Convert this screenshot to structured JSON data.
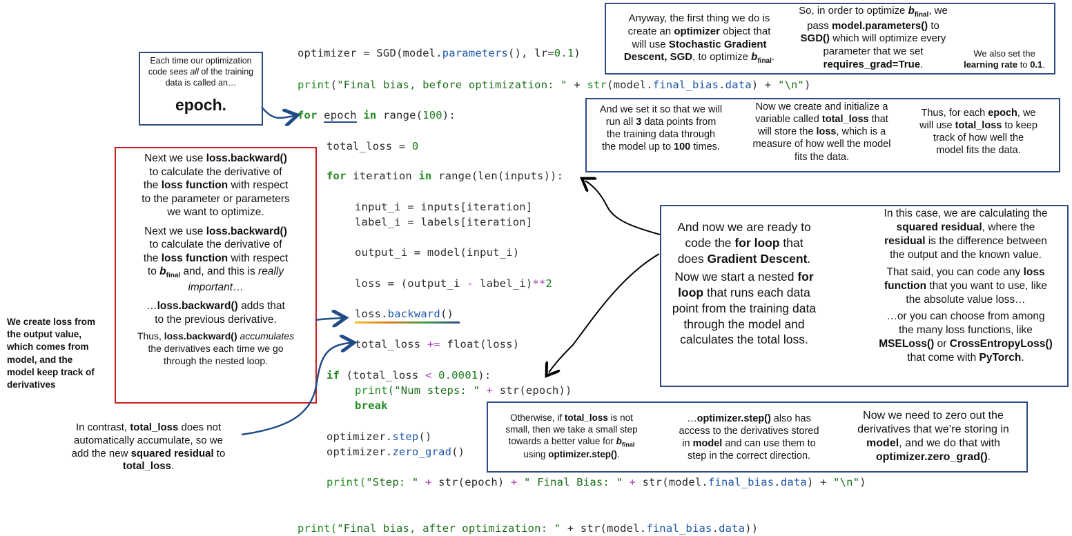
{
  "code": {
    "line1": {
      "a": "optimizer = SGD(model.",
      "b": "parameters",
      "c": "(), lr=",
      "d": "0.1",
      ")": ")"
    },
    "line2": {
      "fn": "print",
      "s": "\"Final bias, before optimization: \"",
      "p": " + ",
      "str": "str",
      "m": "(model.",
      "attr": "final_bias",
      "dot": ".",
      "data": "data",
      "q": ") + ",
      "nl": "\"\\n\"",
      "end": ")"
    },
    "line3": {
      "kw": "for",
      "sp": " ",
      "var": "epoch",
      "in": " in ",
      "rng": "range(",
      "n": "100",
      "end": "):"
    },
    "line4": {
      "a": "total_loss = ",
      "n": "0"
    },
    "line5": {
      "kw": "for",
      "a": " iteration ",
      "in": "in",
      "b": " range(len(inputs)):"
    },
    "line6": "input_i = inputs[iteration]",
    "line7": "label_i = labels[iteration]",
    "line8": "output_i = model(input_i)",
    "line9": {
      "a": "loss = (output_i ",
      "op": "-",
      "b": " label_i)",
      "op2": "**",
      "n": "2"
    },
    "line10": {
      "a": "loss.",
      "b": "backward",
      "c": "()"
    },
    "line11": {
      "a": "total_loss ",
      "op": "+=",
      "b": " float(loss)"
    },
    "line12": {
      "kw": "if",
      "a": " (total_loss ",
      "op": "<",
      "n": " 0.0001",
      "b": "):"
    },
    "line13": {
      "fn": "print",
      "s": "(\"Num steps: \"",
      "op": " + ",
      "b": "str(epoch))"
    },
    "line14": "break",
    "line15": {
      "a": "optimizer.",
      "b": "step",
      "c": "()"
    },
    "line16": {
      "a": "optimizer.",
      "b": "zero_grad",
      "c": "()"
    },
    "line17": {
      "fn": "print(",
      "s1": "\"Step: \"",
      "p1": " + ",
      "a": "str(epoch)",
      "p2": " + ",
      "s2": "\" Final Bias: \"",
      "p3": " + ",
      "b": "str(model.",
      "attr": "final_bias",
      "c": ".",
      "d": "data",
      "e": ") + ",
      "nl": "\"\\n\"",
      "end": ")"
    },
    "line18": {
      "fn": "print(",
      "s": "\"Final bias, after optimization: \"",
      "p": " + ",
      "a": "str(model.",
      "attr": "final_bias",
      "c": ".",
      "d": "data",
      "end": "))"
    }
  },
  "notes": {
    "epoch_box": {
      "l1": "Each time our optimization",
      "l2a": "code sees ",
      "l2b": "all",
      "l2c": " of the training",
      "l3": "data is called an…",
      "big": "epoch."
    },
    "optimizer_note": {
      "t1": "Anyway, the first thing we do is",
      "t2a": "create an ",
      "t2b": "optimizer",
      "t2c": " object that",
      "t3": "will use ",
      "t3b": "Stochastic Gradient",
      "t4": "Descent, SGD",
      "t4b": ", to optimize ",
      "t4c": "b",
      "t4d": "final",
      "t4e": "."
    },
    "params_note": {
      "t1a": "So, in order to optimize ",
      "t1b": "b",
      "t1c": "final",
      "t1d": ", we",
      "t2a": "pass ",
      "t2b": "model.parameters()",
      "t2c": " to",
      "t3a": "SGD()",
      "t3b": " which will optimize every",
      "t4": "parameter that we set",
      "t5": "requires_grad=True",
      "t5b": "."
    },
    "lr_note": {
      "t1": "We also set the",
      "t2": "learning rate",
      "t3": " to ",
      "t4": "0.1",
      "t5": "."
    },
    "run_note": {
      "t1": "And we set it so that we will",
      "t2a": "run all ",
      "t2b": "3",
      "t2c": " data points from",
      "t3": "the training data through",
      "t4a": "the model up to ",
      "t4b": "100",
      "t4c": " times."
    },
    "totalloss_note": {
      "t1": "Now we create and initialize a",
      "t2a": "variable called ",
      "t2b": "total_loss",
      "t2c": " that",
      "t3a": "will store the ",
      "t3b": "loss",
      "t3c": ", which is a",
      "t4": "measure of how well the model",
      "t5": "fits the data."
    },
    "epoch_note": {
      "t1a": "Thus, for each ",
      "t1b": "epoch",
      "t1c": ", we",
      "t2a": "will use ",
      "t2b": "total_loss",
      "t2c": " to keep",
      "t3": "track of how well the",
      "t4": "model fits the data."
    },
    "backward_note": {
      "p1l1a": "Next we use ",
      "p1l1b": "loss.backward()",
      "p1l2": "to calculate the derivative of",
      "p1l3a": "the ",
      "p1l3b": "loss function",
      "p1l3c": " with respect",
      "p1l4": "to the parameter or parameters",
      "p1l5": "we want to optimize.",
      "p2l1a": "Next we use ",
      "p2l1b": "loss.backward()",
      "p2l2": "to calculate the derivative of",
      "p2l3a": "the ",
      "p2l3b": "loss function",
      "p2l3c": " with respect",
      "p2l4a": "to ",
      "p2l4b": "b",
      "p2l4c": "final",
      "p2l4d": " and, and this is ",
      "p2l4e": "really",
      "p2l5": "important",
      "p2l5b": "…",
      "p3l1a": "…",
      "p3l1b": "loss.backward()",
      "p3l1c": " adds that",
      "p3l2": "to the previous derivative.",
      "p4l1a": "Thus, ",
      "p4l1b": "loss.backward()",
      "p4l1c": " accumulates",
      "p4l2": "the derivatives each time we go",
      "p4l3": "through the nested loop."
    },
    "left_note": [
      "We create loss from",
      "the output value,",
      "which comes from",
      "model, and the",
      "model keep track of",
      "derivatives"
    ],
    "contrast_note": {
      "t1a": "In contrast, ",
      "t1b": "total_loss",
      "t1c": " does not",
      "t2": "automatically accumulate, so we",
      "t3a": "add the new ",
      "t3b": "squared residual",
      "t3c": " to",
      "t4": "total_loss",
      "t4b": "."
    },
    "forloop_note": {
      "t1": "And now we are ready to",
      "t2a": "code the ",
      "t2b": "for loop",
      "t2c": " that",
      "t3a": "does ",
      "t3b": "Gradient Descent",
      "t3c": ".",
      "t4a": "Now we start a nested ",
      "t4b": "for",
      "t5a": "loop",
      "t5b": " that runs each data",
      "t6": "point from the training data",
      "t7": "through the model and",
      "t8": "calculates the total loss."
    },
    "residual_note": {
      "t1": "In this case, we are calculating the",
      "t2": "squared residual",
      "t2b": ", where the",
      "t3": "residual",
      "t3b": " is the difference between",
      "t4": "the output and the known value.",
      "t5a": "That said, you can code any ",
      "t5b": "loss",
      "t6": "function",
      "t6b": " that you want to use, like",
      "t7": "the absolute value loss…",
      "t8": "…or you can choose from among",
      "t9": "the many loss functions, like",
      "t10a": "MSELoss()",
      "t10b": " or ",
      "t10c": "CrossEntropyLoss()",
      "t11a": "that come with ",
      "t11b": "PyTorch",
      "t11c": "."
    },
    "step_note": {
      "t1a": "Otherwise, if ",
      "t1b": "total_loss",
      "t1c": " is not",
      "t2": "small, then we take a small step",
      "t3a": "towards a better value for ",
      "t3b": "b",
      "t3c": "final",
      "t4a": "using ",
      "t4b": "optimizer.step()",
      "t4c": "."
    },
    "step2_note": {
      "t1a": "…",
      "t1b": "optimizer.step()",
      "t1c": " also has",
      "t2": "access to the derivatives stored",
      "t3a": "in ",
      "t3b": "model",
      "t3c": " and can use them to",
      "t4": "step in the correct direction."
    },
    "zero_note": {
      "t1": "Now we need to zero out the",
      "t2": "derivatives that we’re storing in",
      "t3a": "model",
      "t3b": ", and we do that with",
      "t4": "optimizer.zero_grad()",
      "t4b": "."
    }
  },
  "colors": {
    "box_blue": "#2e4b87",
    "box_red": "#cc1f1f",
    "keyword": "#1f8a1f",
    "attr": "#1c56a8",
    "op": "#a83ab3"
  }
}
